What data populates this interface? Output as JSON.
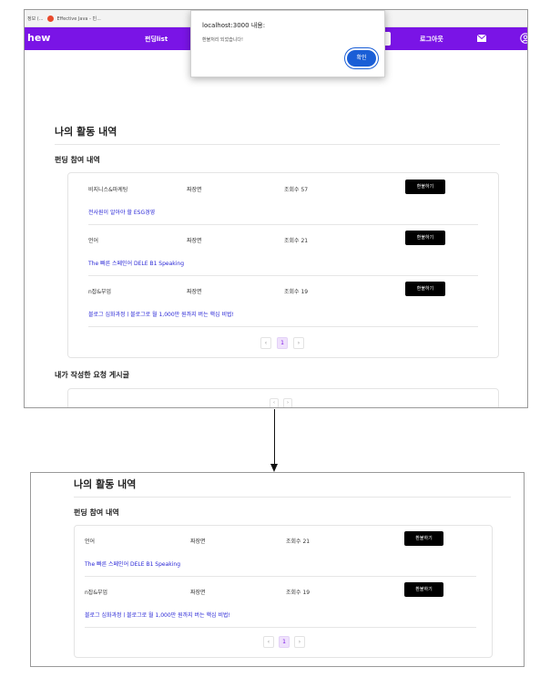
{
  "browser": {
    "bookmark_1": "정보 (...",
    "bookmark_2": "Effective Java - 빈..."
  },
  "nav": {
    "brand": "hew",
    "funding_list": "펀딩list",
    "logout": "로그아웃"
  },
  "alert": {
    "title": "localhost:3000 내용:",
    "message": "환불처리 되었습니다!",
    "ok_label": "확인"
  },
  "activity": {
    "title": "나의 활동 내역",
    "funding_section": "펀딩 참여 내역",
    "request_section": "내가 작성한 요청 게시글",
    "cancel_label": "환불하기",
    "before": [
      {
        "category": "비지니스&마케팅",
        "author": "짜장면",
        "views": "조회수 57",
        "title": "전사원이 알아야 할 ESG경영"
      },
      {
        "category": "언어",
        "author": "짜장면",
        "views": "조회수 21",
        "title": "The 빠른 스페인어 DELE B1 Speaking"
      },
      {
        "category": "n잡&부업",
        "author": "짜장면",
        "views": "조회수 19",
        "title": "블로그 심화과정ㅣ블로그로 월 1,000만 원까지 버는 핵심 비법!"
      }
    ],
    "after": [
      {
        "category": "언어",
        "author": "짜장면",
        "views": "조회수 21",
        "title": "The 빠른 스페인어 DELE B1 Speaking"
      },
      {
        "category": "n잡&부업",
        "author": "짜장면",
        "views": "조회수 19",
        "title": "블로그 심화과정ㅣ블로그로 월 1,000만 원까지 버는 핵심 비법!"
      }
    ],
    "pager": {
      "prev": "‹",
      "current": "1",
      "next": "›"
    }
  }
}
